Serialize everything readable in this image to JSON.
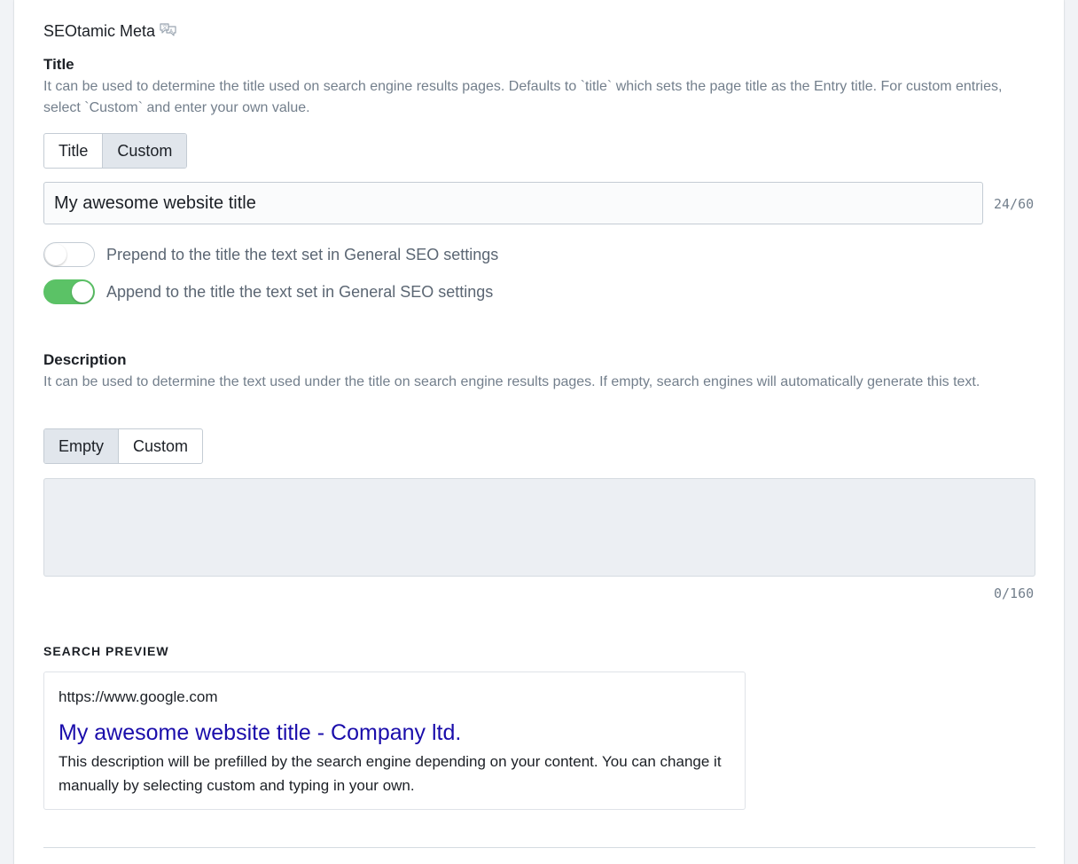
{
  "section": {
    "title": "SEOtamic Meta",
    "icon": "translate-icon"
  },
  "title_field": {
    "label": "Title",
    "help": "It can be used to determine the title used on search engine results pages. Defaults to `title` which sets the page title as the Entry title. For custom entries, select `Custom` and enter your own value.",
    "options": [
      "Title",
      "Custom"
    ],
    "selected": "Custom",
    "value": "My awesome website title",
    "counter": "24/60",
    "toggles": [
      {
        "label": "Prepend to the title the text set in General SEO settings",
        "on": false
      },
      {
        "label": "Append to the title the text set in General SEO settings",
        "on": true
      }
    ]
  },
  "description_field": {
    "label": "Description",
    "help": "It can be used to determine the text used under the title on search engine results pages. If empty, search engines will automatically generate this text.",
    "options": [
      "Empty",
      "Custom"
    ],
    "selected": "Empty",
    "value": "",
    "counter": "0/160"
  },
  "search_preview": {
    "heading": "SEARCH PREVIEW",
    "url": "https://www.google.com",
    "title": "My awesome website title - Company ltd.",
    "description": "This description will be prefilled by the search engine depending on your content. You can change it manually by selecting custom and typing in your own."
  },
  "colors": {
    "toggle_on": "#5bc266",
    "link_blue": "#1a0dab",
    "help_text": "#737f8c",
    "active_segment": "#e1e6ec"
  }
}
